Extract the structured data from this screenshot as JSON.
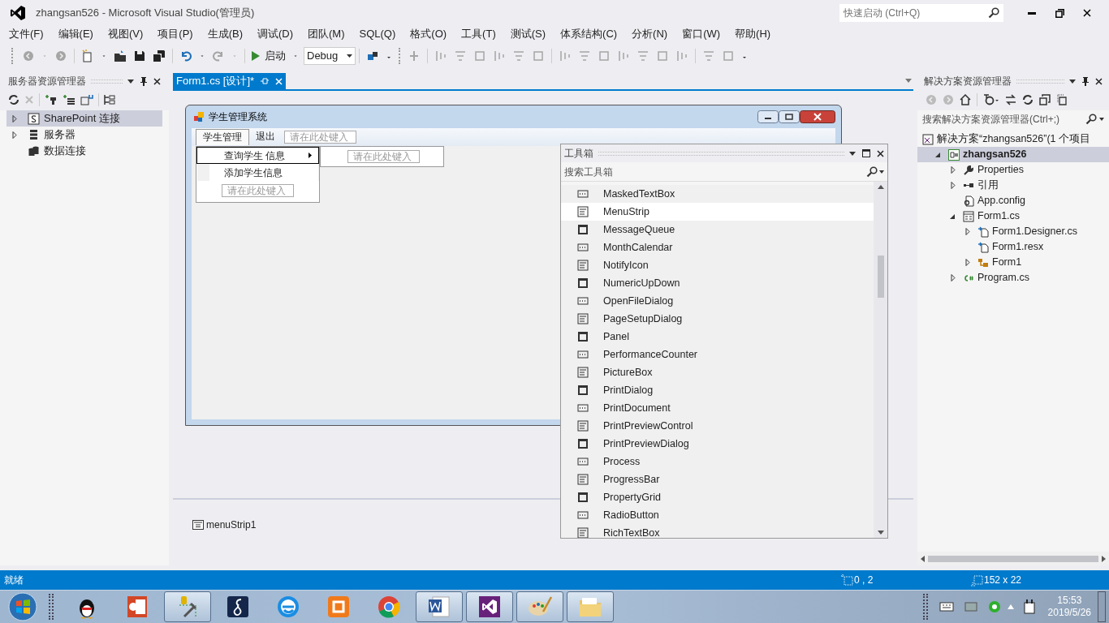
{
  "window": {
    "title": "zhangsan526 - Microsoft Visual Studio(管理员)"
  },
  "quick_launch": {
    "placeholder": "快速启动 (Ctrl+Q)"
  },
  "menu_bar": [
    "文件(F)",
    "编辑(E)",
    "视图(V)",
    "项目(P)",
    "生成(B)",
    "调试(D)",
    "团队(M)",
    "SQL(Q)",
    "格式(O)",
    "工具(T)",
    "测试(S)",
    "体系结构(C)",
    "分析(N)",
    "窗口(W)",
    "帮助(H)"
  ],
  "toolbar": {
    "start_label": "启动",
    "configuration": "Debug"
  },
  "server_explorer": {
    "title": "服务器资源管理器",
    "items": [
      {
        "label": "SharePoint 连接",
        "kind": "sharepoint",
        "expanded": false,
        "selected": true
      },
      {
        "label": "服务器",
        "kind": "server",
        "expanded": false,
        "selected": false
      },
      {
        "label": "数据连接",
        "kind": "data",
        "selected": false
      }
    ]
  },
  "document_tabs": [
    {
      "label": "Form1.cs [设计]*",
      "selected": true
    }
  ],
  "form": {
    "title": "学生管理系统",
    "menu": [
      {
        "label": "学生管理",
        "selected": true
      },
      {
        "label": "退出",
        "selected": false
      }
    ],
    "menu_placeholder": "请在此处键入",
    "dropdown": [
      {
        "label": "查询学生 信息",
        "has_submenu": true,
        "selected": true
      },
      {
        "label": "添加学生信息",
        "has_submenu": false,
        "selected": false
      }
    ],
    "dropdown_placeholder": "请在此处键入",
    "submenu_placeholder": "请在此处键入"
  },
  "component_tray": [
    "menuStrip1"
  ],
  "toolbox": {
    "title": "工具箱",
    "search_placeholder": "搜索工具箱",
    "items": [
      {
        "label": "MaskedTextBox",
        "selected": false
      },
      {
        "label": "MenuStrip",
        "selected": true
      },
      {
        "label": "MessageQueue",
        "selected": false
      },
      {
        "label": "MonthCalendar",
        "selected": false
      },
      {
        "label": "NotifyIcon",
        "selected": false
      },
      {
        "label": "NumericUpDown",
        "selected": false
      },
      {
        "label": "OpenFileDialog",
        "selected": false
      },
      {
        "label": "PageSetupDialog",
        "selected": false
      },
      {
        "label": "Panel",
        "selected": false
      },
      {
        "label": "PerformanceCounter",
        "selected": false
      },
      {
        "label": "PictureBox",
        "selected": false
      },
      {
        "label": "PrintDialog",
        "selected": false
      },
      {
        "label": "PrintDocument",
        "selected": false
      },
      {
        "label": "PrintPreviewControl",
        "selected": false
      },
      {
        "label": "PrintPreviewDialog",
        "selected": false
      },
      {
        "label": "Process",
        "selected": false
      },
      {
        "label": "ProgressBar",
        "selected": false
      },
      {
        "label": "PropertyGrid",
        "selected": false
      },
      {
        "label": "RadioButton",
        "selected": false
      },
      {
        "label": "RichTextBox",
        "selected": false
      }
    ]
  },
  "solution_explorer": {
    "title": "解决方案资源管理器",
    "search_placeholder": "搜索解决方案资源管理器(Ctrl+;)",
    "tree": [
      {
        "label": "解决方案“zhangsan526”(1 个项目",
        "kind": "solution",
        "selected": false,
        "children": [
          {
            "label": "zhangsan526",
            "kind": "project",
            "expanded": true,
            "selected": true,
            "children": [
              {
                "label": "Properties",
                "kind": "wrench",
                "expanded": false,
                "selected": false
              },
              {
                "label": "引用",
                "kind": "references",
                "expanded": false,
                "selected": false
              },
              {
                "label": "App.config",
                "kind": "config",
                "selected": false
              },
              {
                "label": "Form1.cs",
                "kind": "form",
                "expanded": true,
                "selected": false,
                "children": [
                  {
                    "label": "Form1.Designer.cs",
                    "kind": "file",
                    "expanded": false,
                    "selected": false
                  },
                  {
                    "label": "Form1.resx",
                    "kind": "file",
                    "selected": false
                  },
                  {
                    "label": "Form1",
                    "kind": "class",
                    "expanded": false,
                    "selected": false
                  }
                ]
              },
              {
                "label": "Program.cs",
                "kind": "csharp",
                "expanded": false,
                "selected": false
              }
            ]
          }
        ]
      }
    ]
  },
  "status_bar": {
    "text": "就绪",
    "position": "0 , 2",
    "size": "152 x 22"
  },
  "taskbar": {
    "apps": [
      {
        "kind": "penguin",
        "running": false
      },
      {
        "kind": "slides",
        "running": false
      },
      {
        "kind": "tools",
        "running": true
      },
      {
        "kind": "eight",
        "running": false
      },
      {
        "kind": "browser-e",
        "running": false
      },
      {
        "kind": "orange",
        "running": false
      },
      {
        "kind": "chrome",
        "running": false
      },
      {
        "kind": "word",
        "running": true
      },
      {
        "kind": "vs",
        "running": true
      },
      {
        "kind": "paint",
        "running": true
      },
      {
        "kind": "folder",
        "running": true
      }
    ],
    "time": "15:53",
    "date": "2019/5/26"
  }
}
